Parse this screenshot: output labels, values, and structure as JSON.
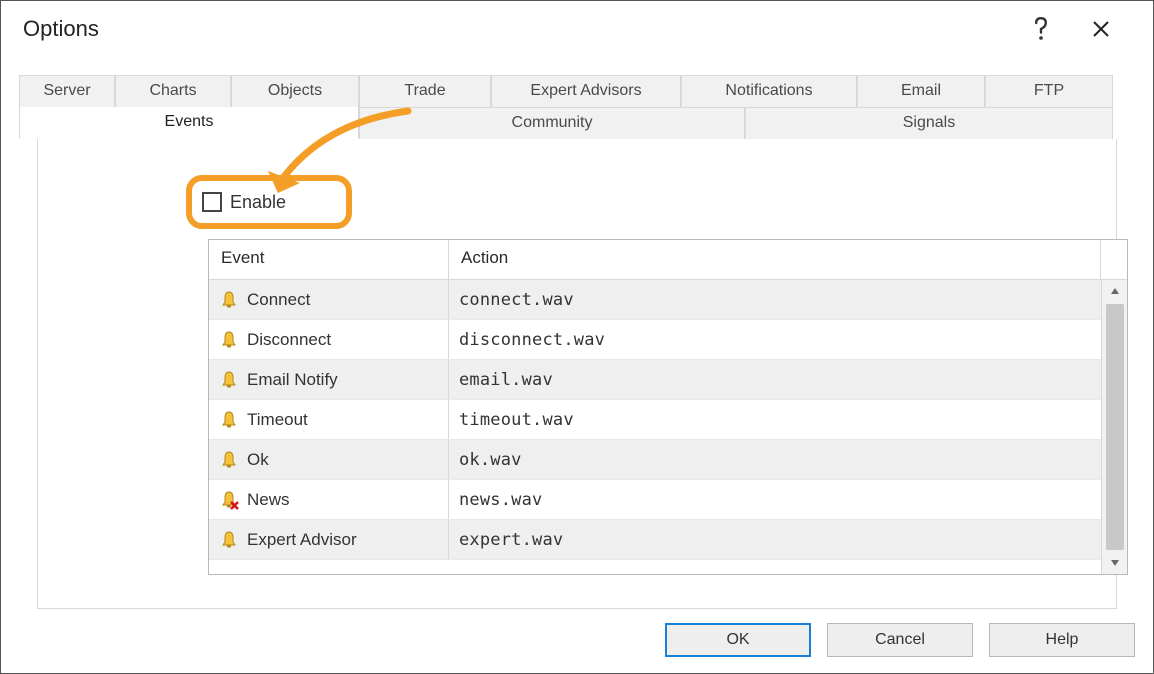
{
  "window": {
    "title": "Options"
  },
  "tabs_row1": {
    "server": "Server",
    "charts": "Charts",
    "objects": "Objects",
    "trade": "Trade",
    "expert_advisors": "Expert Advisors",
    "notifications": "Notifications",
    "email": "Email",
    "ftp": "FTP"
  },
  "tabs_row2": {
    "events": "Events",
    "community": "Community",
    "signals": "Signals"
  },
  "enable": {
    "label": "Enable",
    "checked": false
  },
  "table": {
    "headers": {
      "event": "Event",
      "action": "Action"
    },
    "rows": [
      {
        "icon": "bell",
        "event": "Connect",
        "action": "connect.wav"
      },
      {
        "icon": "bell",
        "event": "Disconnect",
        "action": "disconnect.wav"
      },
      {
        "icon": "bell",
        "event": "Email Notify",
        "action": "email.wav"
      },
      {
        "icon": "bell",
        "event": "Timeout",
        "action": "timeout.wav"
      },
      {
        "icon": "bell",
        "event": "Ok",
        "action": "ok.wav"
      },
      {
        "icon": "bell-x",
        "event": "News",
        "action": "news.wav"
      },
      {
        "icon": "bell",
        "event": "Expert Advisor",
        "action": "expert.wav"
      }
    ]
  },
  "buttons": {
    "ok": "OK",
    "cancel": "Cancel",
    "help": "Help"
  },
  "colors": {
    "highlight": "#f59e27",
    "primary": "#1a7fd6"
  }
}
